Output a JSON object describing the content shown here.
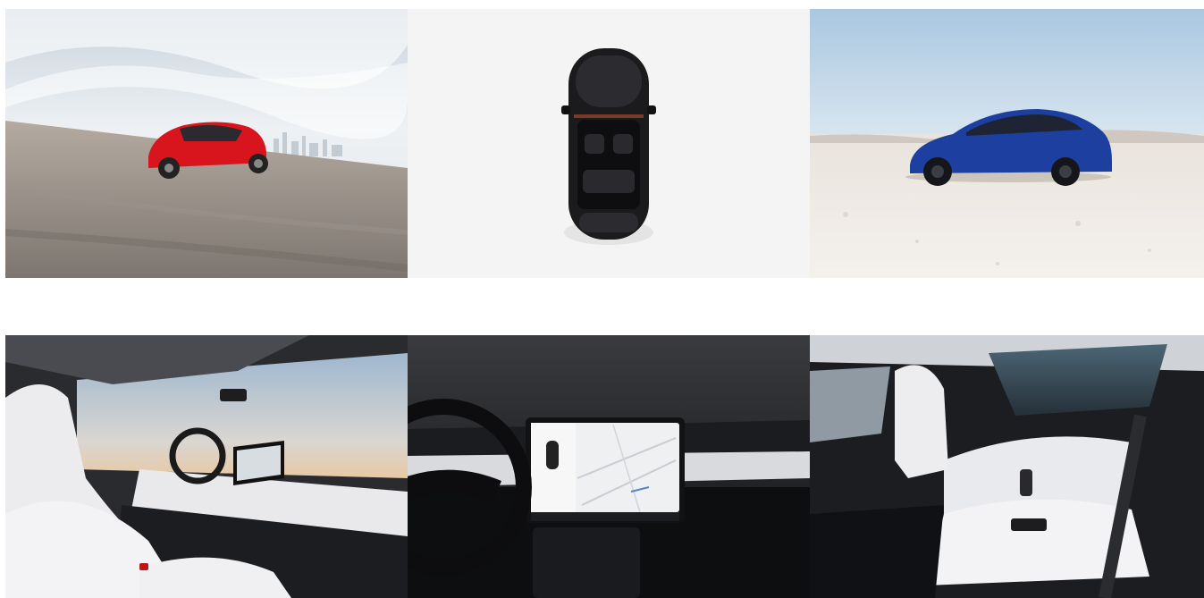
{
  "gallery": {
    "images": [
      {
        "subject": "red-suv-driving-on-runway",
        "accent": "#d8141c"
      },
      {
        "subject": "black-suv-top-view-glass-roof",
        "accent": "#1a1a1a"
      },
      {
        "subject": "blue-suv-side-profile-desert",
        "accent": "#1c3fa0"
      },
      {
        "subject": "front-cabin-white-seats-touchscreen",
        "accent": "#e9e9ec"
      },
      {
        "subject": "dashboard-touchscreen-steering-wheel",
        "accent": "#141414"
      },
      {
        "subject": "rear-cabin-white-seats",
        "accent": "#d8d9dc"
      }
    ]
  }
}
